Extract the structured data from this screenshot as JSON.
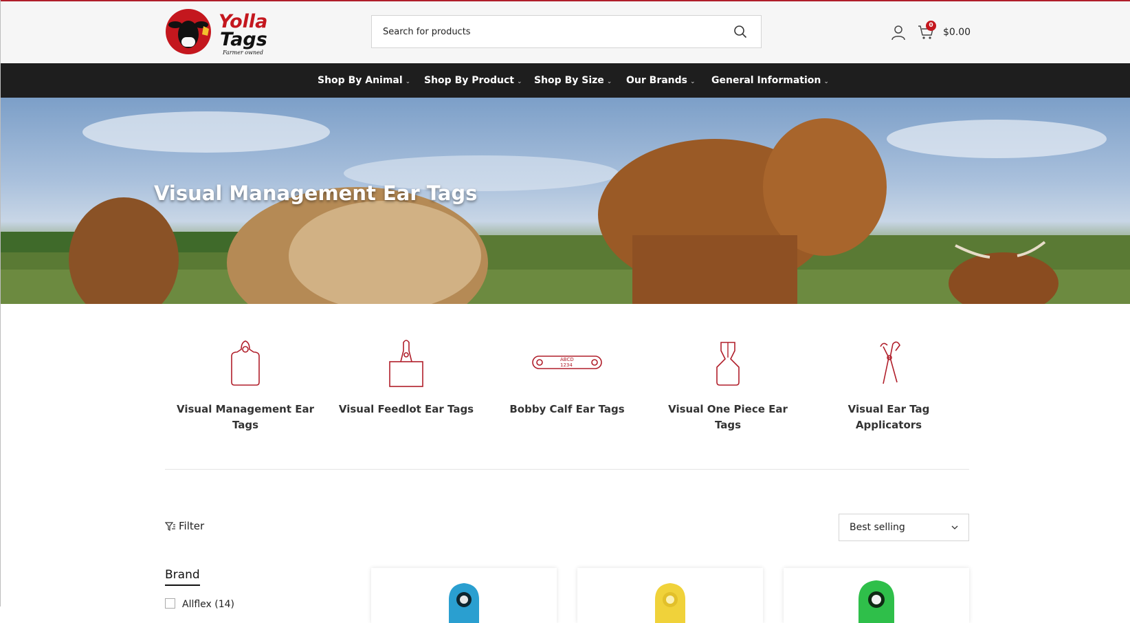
{
  "brand": {
    "name": "Yolla Tags",
    "tagline": "Farmer owned",
    "colors": {
      "primary": "#c4171e",
      "dark": "#1e1e1e",
      "logo_yellow": "#f2c12e"
    }
  },
  "search": {
    "placeholder": "Search for products",
    "icon": "search-icon"
  },
  "header": {
    "account_icon": "user-icon",
    "cart_icon": "cart-icon",
    "cart_count": "0",
    "cart_total": "$0.00"
  },
  "nav": {
    "items": [
      {
        "label": "Shop By Animal"
      },
      {
        "label": "Shop By Product"
      },
      {
        "label": "Shop By Size"
      },
      {
        "label": "Our Brands"
      },
      {
        "label": "General Information"
      }
    ]
  },
  "hero": {
    "title": "Visual Management Ear Tags"
  },
  "categories": [
    {
      "label": "Visual Management Ear Tags",
      "icon": "management-tag-icon"
    },
    {
      "label": "Visual Feedlot Ear Tags",
      "icon": "feedlot-tag-icon"
    },
    {
      "label": "Bobby Calf Ear Tags",
      "icon": "bobby-calf-tag-icon",
      "icon_text": [
        "ABCD",
        "1234"
      ]
    },
    {
      "label": "Visual One Piece Ear Tags",
      "icon": "one-piece-tag-icon"
    },
    {
      "label": "Visual Ear Tag Applicators",
      "icon": "applicator-icon"
    }
  ],
  "toolbar": {
    "filter_label": "Filter",
    "sort_value": "Best selling"
  },
  "filters": {
    "brand_title": "Brand",
    "options": [
      {
        "label": "Allflex (14)"
      }
    ]
  },
  "products": [
    {
      "tag_color": "#2a9fd0"
    },
    {
      "tag_color": "#f0d23a"
    },
    {
      "tag_color": "#2fbf4a"
    }
  ]
}
